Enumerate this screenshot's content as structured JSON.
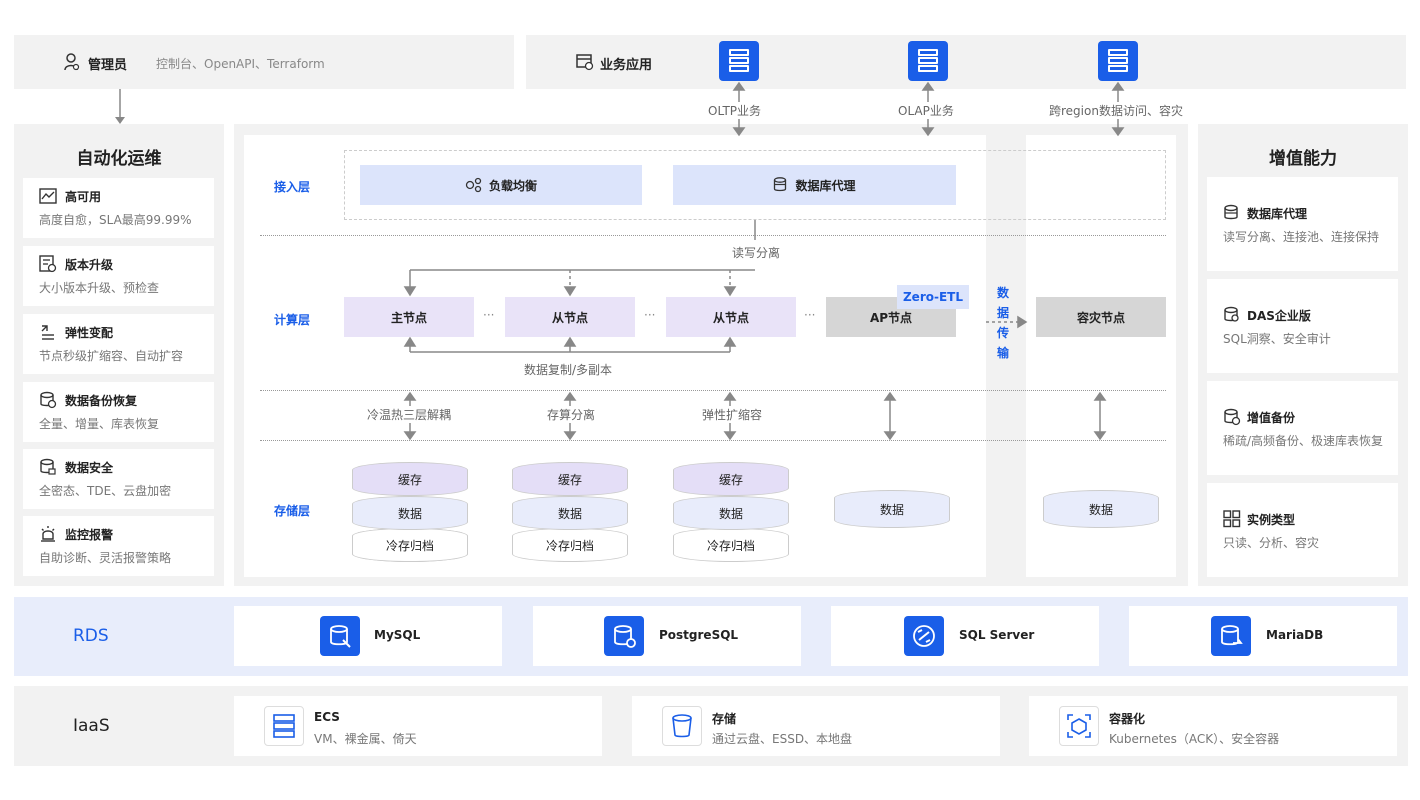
{
  "top": {
    "admin": {
      "label": "管理员",
      "sub": "控制台、OpenAPI、Terraform"
    },
    "app": {
      "label": "业务应用"
    },
    "flows": [
      "OLTP业务",
      "OLAP业务",
      "跨region数据访问、容灾"
    ]
  },
  "left": {
    "title": "自动化运维",
    "items": [
      {
        "title": "高可用",
        "desc": "高度自愈，SLA最高99.99%"
      },
      {
        "title": "版本升级",
        "desc": "大小版本升级、预检查"
      },
      {
        "title": "弹性变配",
        "desc": "节点秒级扩缩容、自动扩容"
      },
      {
        "title": "数据备份恢复",
        "desc": "全量、增量、库表恢复"
      },
      {
        "title": "数据安全",
        "desc": "全密态、TDE、云盘加密"
      },
      {
        "title": "监控报警",
        "desc": "自助诊断、灵活报警策略"
      }
    ]
  },
  "right": {
    "title": "增值能力",
    "items": [
      {
        "title": "数据库代理",
        "desc": "读写分离、连接池、连接保持"
      },
      {
        "title": "DAS企业版",
        "desc": "SQL洞察、安全审计"
      },
      {
        "title": "增值备份",
        "desc": "稀疏/高频备份、极速库表恢复"
      },
      {
        "title": "实例类型",
        "desc": "只读、分析、容灾"
      }
    ]
  },
  "center": {
    "layers": {
      "access": "接入层",
      "compute": "计算层",
      "storage": "存储层"
    },
    "access": {
      "lb": "负载均衡",
      "proxy": "数据库代理"
    },
    "rw_split": "读写分离",
    "nodes": {
      "primary": "主节点",
      "replica": "从节点",
      "ap": "AP节点",
      "dr": "容灾节点"
    },
    "zero_etl": "Zero-ETL",
    "transfer": [
      "数",
      "据",
      "传",
      "输"
    ],
    "replication": "数据复制/多副本",
    "storage_features": [
      "冷温热三层解耦",
      "存算分离",
      "弹性扩缩容"
    ],
    "storage": {
      "cache": "缓存",
      "data": "数据",
      "cold": "冷存归档"
    },
    "ellipsis": "···"
  },
  "rds": {
    "label": "RDS",
    "engines": [
      "MySQL",
      "PostgreSQL",
      "SQL Server",
      "MariaDB"
    ]
  },
  "iaas": {
    "label": "IaaS",
    "items": [
      {
        "title": "ECS",
        "desc": "VM、裸金属、倚天"
      },
      {
        "title": "存储",
        "desc": "通过云盘、ESSD、本地盘"
      },
      {
        "title": "容器化",
        "desc": "Kubernetes（ACK）、安全容器"
      }
    ]
  },
  "colors": {
    "accent": "#1a5ee8",
    "panel": "#f2f2f2",
    "rds_bg": "#e8edfb",
    "lavender": "#e9e3f8",
    "light_blue": "#dce4fb"
  }
}
